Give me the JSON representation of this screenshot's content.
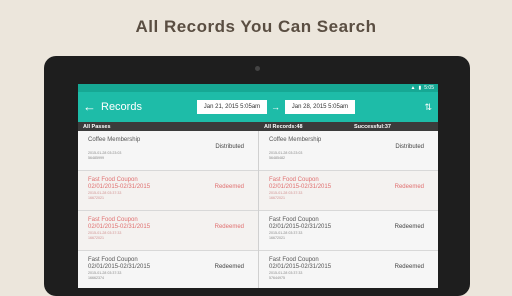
{
  "headline": "All Records You Can Search",
  "statusbar": {
    "time": "5:05"
  },
  "appbar": {
    "title": "Records",
    "start_date": "Jan 21, 2015 5:05am",
    "end_date": "Jan 28, 2015 5:05am"
  },
  "columns_header": {
    "left": "All Passes",
    "records": "All Records:48",
    "successful": "Successful:37"
  },
  "left_rows": [
    {
      "name": "Coffee Membership",
      "dates": "",
      "meta1": "2015-01-28 03:23:03",
      "meta2": "56485999",
      "status": "Distributed",
      "style": "normal"
    },
    {
      "name": "Fast Food Coupon",
      "dates": "02/01/2015-02/31/2015",
      "meta1": "2015-01-28 03:37:33",
      "meta2": "16672021",
      "status": "Redeemed",
      "style": "red"
    },
    {
      "name": "Fast Food Coupon",
      "dates": "02/01/2015-02/31/2015",
      "meta1": "2015-01-28 03:37:33",
      "meta2": "16672021",
      "status": "Redeemed",
      "style": "red"
    },
    {
      "name": "Fast Food Coupon",
      "dates": "02/01/2015-02/31/2015",
      "meta1": "2015-01-28 03:37:33",
      "meta2": "16662374",
      "status": "Redeemed",
      "style": "normal"
    }
  ],
  "right_rows": [
    {
      "name": "Coffee Membership",
      "dates": "",
      "meta1": "2015-01-28 03:23:03",
      "meta2": "56485482",
      "status": "Distributed",
      "style": "normal"
    },
    {
      "name": "Fast Food Coupon",
      "dates": "02/01/2015-02/31/2015",
      "meta1": "2015-01-28 03:37:33",
      "meta2": "16672021",
      "status": "Redeemed",
      "style": "red"
    },
    {
      "name": "Fast Food Coupon",
      "dates": "02/01/2015-02/31/2015",
      "meta1": "2015-01-28 03:37:33",
      "meta2": "16672021",
      "status": "Redeemed",
      "style": "normal"
    },
    {
      "name": "Fast Food Coupon",
      "dates": "02/01/2015-02/31/2015",
      "meta1": "2015-01-28 03:37:33",
      "meta2": "57644975",
      "status": "Redeemed",
      "style": "normal"
    }
  ],
  "colors": {
    "accent": "#1ebca8",
    "redeemed_red": "#e07070"
  }
}
